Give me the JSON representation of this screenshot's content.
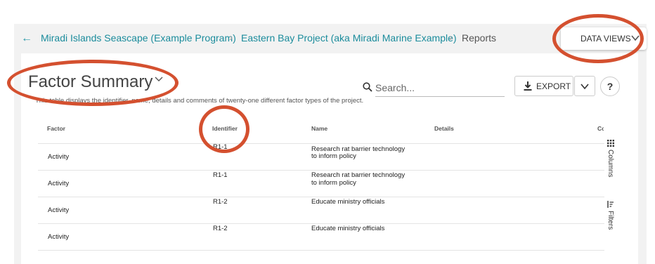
{
  "breadcrumb": {
    "items": [
      {
        "label": "Miradi Islands Seascape (Example Program)"
      },
      {
        "label": "Eastern Bay Project (aka Miradi Marine Example)"
      },
      {
        "label": "Reports"
      }
    ]
  },
  "data_views": {
    "label": "DATA VIEWS"
  },
  "page": {
    "title": "Factor Summary",
    "description": "This table displays the identifier, name, details and comments of twenty-one different factor types of the project."
  },
  "search": {
    "placeholder": "Search..."
  },
  "toolbar": {
    "export_label": "EXPORT",
    "help_label": "?"
  },
  "table": {
    "columns": [
      "Factor",
      "Identifier",
      "Name",
      "Details",
      "Co"
    ],
    "rows": [
      {
        "factor": "Activity",
        "identifier": "R1-1",
        "name_line1": "Research rat barrier technology",
        "name_line2": "to inform policy",
        "details": ""
      },
      {
        "factor": "Activity",
        "identifier": "R1-1",
        "name_line1": "Research rat barrier technology",
        "name_line2": "to inform policy",
        "details": ""
      },
      {
        "factor": "Activity",
        "identifier": "R1-2",
        "name_line1": "Educate ministry officials",
        "name_line2": "",
        "details": ""
      },
      {
        "factor": "Activity",
        "identifier": "R1-2",
        "name_line1": "Educate ministry officials",
        "name_line2": "",
        "details": ""
      }
    ]
  },
  "side_panel": {
    "columns_label": "Columns",
    "filters_label": "Filters"
  },
  "colors": {
    "accent": "#1b8c9c",
    "annotation": "#d4502f"
  },
  "icons": [
    "back-arrow-icon",
    "chevron-right-icon",
    "chevron-down-icon",
    "search-icon",
    "download-icon",
    "grid-icon",
    "filter-icon"
  ]
}
